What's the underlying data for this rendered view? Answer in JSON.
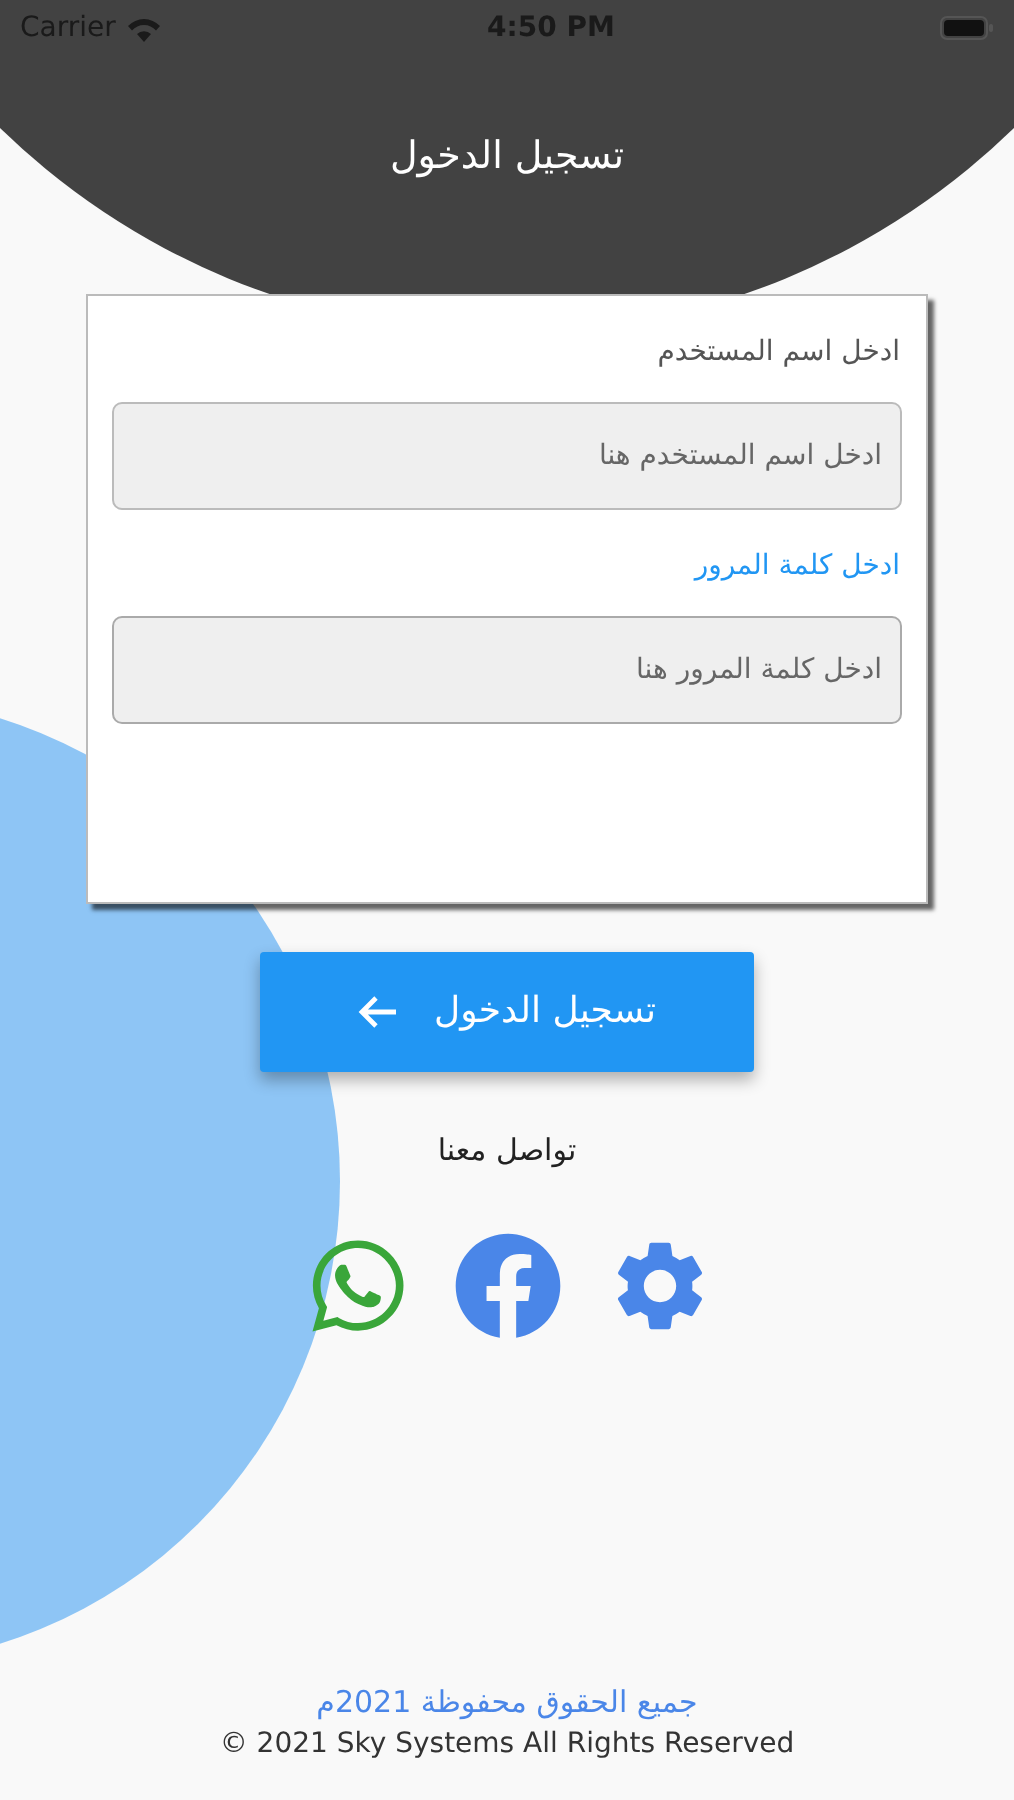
{
  "status_bar": {
    "carrier": "Carrier",
    "time": "4:50 PM"
  },
  "header": {
    "title": "تسجيل الدخول"
  },
  "form": {
    "fields": [
      {
        "label": "ادخل اسم المستخدم",
        "placeholder": "ادخل اسم المستخدم هنا",
        "focused": false
      },
      {
        "label": "ادخل كلمة المرور",
        "placeholder": "ادخل كلمة المرور هنا",
        "focused": true
      }
    ]
  },
  "login_button": {
    "label": "تسجيل الدخول"
  },
  "contact": {
    "title": "تواصل معنا",
    "links": [
      {
        "kind": "whatsapp"
      },
      {
        "kind": "facebook"
      },
      {
        "kind": "settings"
      }
    ]
  },
  "footer": {
    "rights_arabic": "جميع الحقوق محفوظة 2021م",
    "rights_english": "© 2021 Sky Systems All Rights Reserved"
  }
}
